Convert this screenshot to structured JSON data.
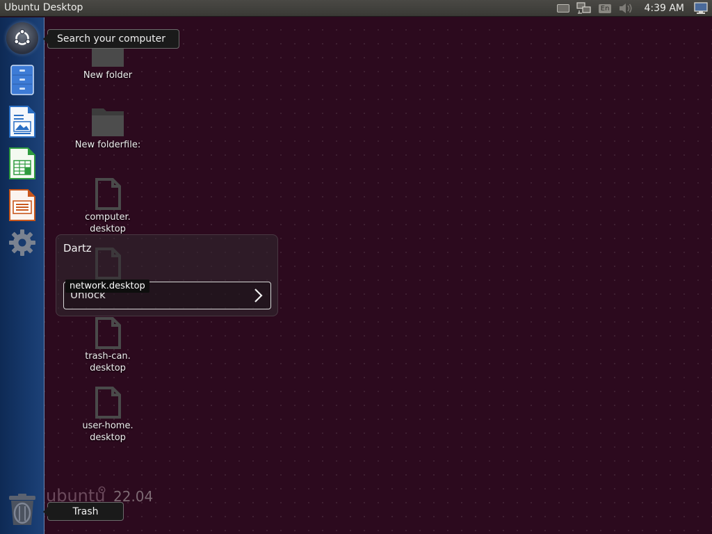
{
  "panel": {
    "title": "Ubuntu Desktop",
    "clock": "4:39 AM",
    "language": "En",
    "indicators": [
      "keyboard-icon",
      "network-icon",
      "language-indicator",
      "volume-icon",
      "session-icon"
    ]
  },
  "launcher": {
    "items": [
      {
        "name": "dash-button",
        "icon": "ubuntu-logo-icon"
      },
      {
        "name": "files",
        "icon": "file-cabinet-icon"
      },
      {
        "name": "libreoffice-writer",
        "icon": "writer-document-icon"
      },
      {
        "name": "libreoffice-calc",
        "icon": "calc-spreadsheet-icon"
      },
      {
        "name": "libreoffice-impress",
        "icon": "impress-presentation-icon"
      },
      {
        "name": "system-settings",
        "icon": "gear-icon"
      },
      {
        "name": "trash",
        "icon": "trash-bin-icon"
      }
    ],
    "search_tooltip": "Search your computer",
    "trash_tooltip": "Trash"
  },
  "desktop": {
    "icons": [
      {
        "label": "New folder",
        "icon": "folder-icon"
      },
      {
        "label": "New folderfile:",
        "icon": "folder-icon"
      },
      {
        "label": "computer.\ndesktop",
        "icon": "file-icon"
      },
      {
        "label": "network.desktop",
        "icon": "file-icon"
      },
      {
        "label": "trash-can.\ndesktop",
        "icon": "file-icon"
      },
      {
        "label": "user-home.\ndesktop",
        "icon": "file-icon"
      }
    ]
  },
  "unlock": {
    "user_name": "Dartz",
    "field_text": "Unlock",
    "file_tooltip": "network.desktop"
  },
  "branding": {
    "name": "ubuntu",
    "version": "22.04"
  }
}
